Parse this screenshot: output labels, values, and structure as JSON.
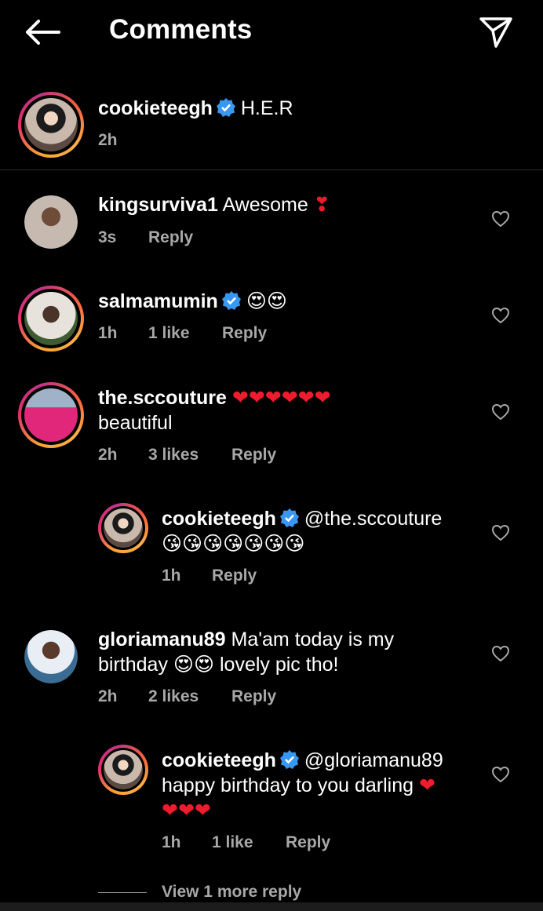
{
  "header": {
    "title": "Comments"
  },
  "caption": {
    "username": "cookieteegh",
    "text": "H.E.R",
    "time": "2h"
  },
  "comments": [
    {
      "username": "kingsurviva1",
      "text": "Awesome",
      "emoji": "❣",
      "time": "3s",
      "likes": "",
      "reply": "Reply"
    },
    {
      "username": "salmamumin",
      "text": "",
      "emoji": "😍😍",
      "time": "1h",
      "likes": "1 like",
      "reply": "Reply"
    },
    {
      "username": "the.sccouture",
      "text": "",
      "emoji": "❤❤❤❤❤❤",
      "text2": "beautiful",
      "time": "2h",
      "likes": "3 likes",
      "reply": "Reply"
    },
    {
      "username": "cookieteegh",
      "text": "@the.sccouture",
      "emoji2": "😘😘😘😘😘😘😘",
      "time": "1h",
      "likes": "",
      "reply": "Reply"
    },
    {
      "username": "gloriamanu89",
      "text": "Ma'am today is my",
      "text2_a": "birthday",
      "emoji": "😍😍",
      "text2_b": "lovely pic tho!",
      "time": "2h",
      "likes": "2 likes",
      "reply": "Reply"
    },
    {
      "username": "cookieteegh",
      "text": "@gloriamanu89",
      "text2": "happy birthday to you darling",
      "emoji": "❤",
      "emoji3": "❤❤❤",
      "time": "1h",
      "likes": "1 like",
      "reply": "Reply"
    }
  ],
  "view_more": "View 1 more reply",
  "colors": {
    "background": "#000000",
    "verified": "#3897f0",
    "heart": "#ee1c2c",
    "meta": "#a8a8a8"
  }
}
